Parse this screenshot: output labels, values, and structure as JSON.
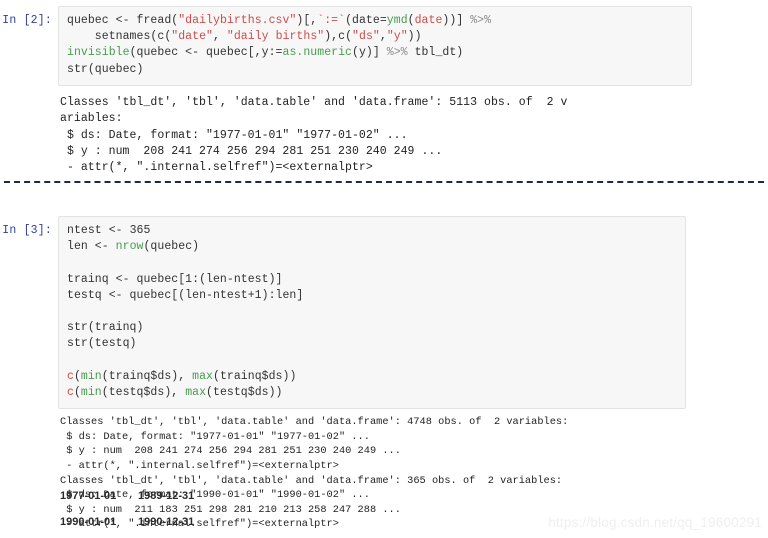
{
  "notebook": {
    "kernel_language": "R",
    "divider_color": "#1b2a4a",
    "cell_bg": "#f7f7f7",
    "cell_border": "#e3e3e3",
    "prompt_color": "#303F9F",
    "string_color": "#d14b4b",
    "function_color": "#4a9a52"
  },
  "cells": [
    {
      "prompt": "In [2]:",
      "source_lines": [
        "quebec <- fread(\"dailybirths.csv\")[,`:=`(date=ymd(date))] %>%",
        "    setnames(c(\"date\", \"daily births\"),c(\"ds\",\"y\"))",
        "invisible(quebec <- quebec[,y:=as.numeric(y)] %>% tbl_dt)",
        "str(quebec)"
      ],
      "output_lines": [
        "Classes 'tbl_dt', 'tbl', 'data.table' and 'data.frame': 5113 obs. of  2 v",
        "ariables:",
        " $ ds: Date, format: \"1977-01-01\" \"1977-01-02\" ...",
        " $ y : num  208 241 274 256 294 281 251 230 240 249 ...",
        " - attr(*, \".internal.selfref\")=<externalptr>"
      ]
    },
    {
      "prompt": "In [3]:",
      "source_lines": [
        "ntest <- 365",
        "len <- nrow(quebec)",
        "",
        "trainq <- quebec[1:(len-ntest)]",
        "testq <- quebec[(len-ntest+1):len]",
        "",
        "str(trainq)",
        "str(testq)",
        "",
        "c(min(trainq$ds), max(trainq$ds))",
        "c(min(testq$ds), max(testq$ds))"
      ],
      "output_lines": [
        "Classes 'tbl_dt', 'tbl', 'data.table' and 'data.frame': 4748 obs. of  2 variables:",
        " $ ds: Date, format: \"1977-01-01\" \"1977-01-02\" ...",
        " $ y : num  208 241 274 256 294 281 251 230 240 249 ...",
        " - attr(*, \".internal.selfref\")=<externalptr>",
        "Classes 'tbl_dt', 'tbl', 'data.table' and 'data.frame': 365 obs. of  2 variables:",
        " $ ds: Date, format: \"1990-01-01\" \"1990-01-02\" ...",
        " $ y : num  211 183 251 298 281 210 213 258 247 288 ...",
        " - attr(*, \".internal.selfref\")=<externalptr>"
      ],
      "result_rows": [
        {
          "first": "1977-01-01",
          "second": "1989-12-31"
        },
        {
          "first": "1990-01-01",
          "second": "1990-12-31"
        }
      ]
    }
  ],
  "watermark": {
    "text": "https://blog.csdn.net/qq_19600291"
  }
}
